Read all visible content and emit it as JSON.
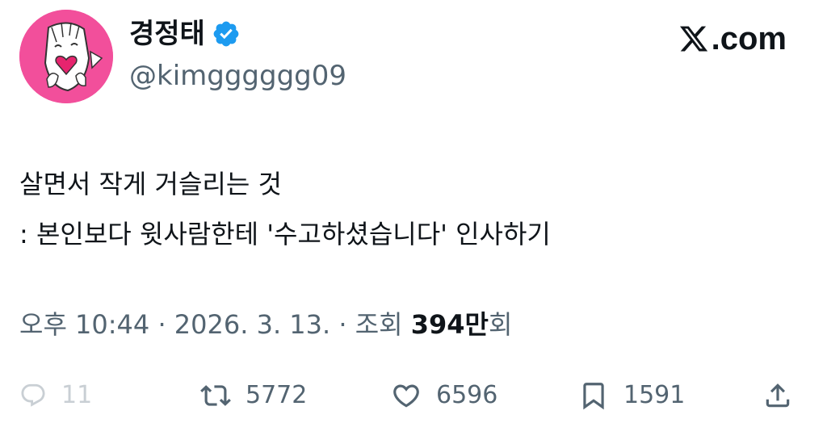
{
  "author": {
    "display_name": "경정태",
    "handle": "@kimgggggg09",
    "avatar_icon": "cartoon-heart-avatar",
    "avatar_bg": "#f24f9b",
    "verified_icon": "verified-badge-icon",
    "verified_color": "#1d9bf0"
  },
  "brand": {
    "logo_icon": "x-logo-icon",
    "text": ".com"
  },
  "tweet": {
    "lines": [
      "살면서 작게 거슬리는 것",
      ": 본인보다 윗사람한테 '수고하셨습니다' 인사하기"
    ]
  },
  "meta": {
    "time": "오후 10:44",
    "sep1": " · ",
    "date": "2026. 3. 13.",
    "sep2": " · ",
    "views_prefix": "조회 ",
    "views_count": "394만",
    "views_suffix": "회"
  },
  "actions": {
    "reply": {
      "icon": "reply-icon",
      "count": "11"
    },
    "retweet": {
      "icon": "retweet-icon",
      "count": "5772"
    },
    "like": {
      "icon": "heart-icon",
      "count": "6596"
    },
    "bookmark": {
      "icon": "bookmark-icon",
      "count": "1591"
    },
    "share": {
      "icon": "share-icon"
    }
  },
  "colors": {
    "text": "#0f1419",
    "secondary": "#536471",
    "muted": "#c9cfd4"
  }
}
